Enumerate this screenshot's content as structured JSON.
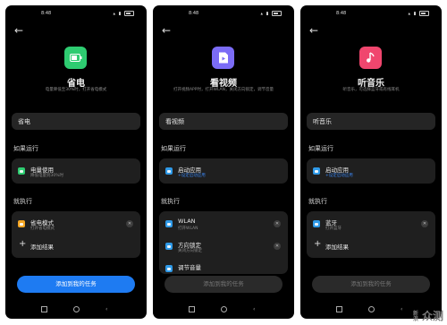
{
  "phones": [
    {
      "time": "8:48",
      "app_title": "省电",
      "description": "电量降低至30%时，打开省电模式",
      "name_field": "省电",
      "if_label": "如果运行",
      "condition": {
        "title": "电量使用",
        "subtitle": "降低电量到30%时"
      },
      "then_label": "就执行",
      "actions": [
        {
          "title": "省电模式",
          "subtitle": "打开省电模式"
        }
      ],
      "add_result": "添加结果",
      "button": "添加到我的任务"
    },
    {
      "time": "8:48",
      "app_title": "看视频",
      "description": "打开视频APP时，打开WLAN，关闭方向锁定，调节音量",
      "name_field": "看视频",
      "if_label": "如果运行",
      "condition": {
        "title": "启动应用",
        "subtitle": "+设定启动应用"
      },
      "then_label": "就执行",
      "actions": [
        {
          "title": "WLAN",
          "subtitle": "打开WLAN"
        },
        {
          "title": "方向锁定",
          "subtitle": "关闭方向锁定"
        },
        {
          "title": "调节音量",
          "subtitle": ""
        }
      ],
      "button": "添加到我的任务"
    },
    {
      "time": "8:48",
      "app_title": "听音乐",
      "description": "听音乐，可选择蓝牙或有线耳机",
      "name_field": "听音乐",
      "if_label": "如果运行",
      "condition": {
        "title": "启动应用",
        "subtitle": "+设定启动应用"
      },
      "then_label": "就执行",
      "actions": [
        {
          "title": "蓝牙",
          "subtitle": "打开蓝牙"
        }
      ],
      "add_result": "添加结果",
      "button": "添加到我的任务"
    }
  ],
  "watermark": {
    "main": "众测",
    "side": "新浪"
  },
  "colors": {
    "battery_green": "#2ecc71",
    "video_purple": "#7b6cf6",
    "music_pink": "#f0466e",
    "button_blue": "#1e7bf2",
    "link_blue": "#3b86f0"
  }
}
